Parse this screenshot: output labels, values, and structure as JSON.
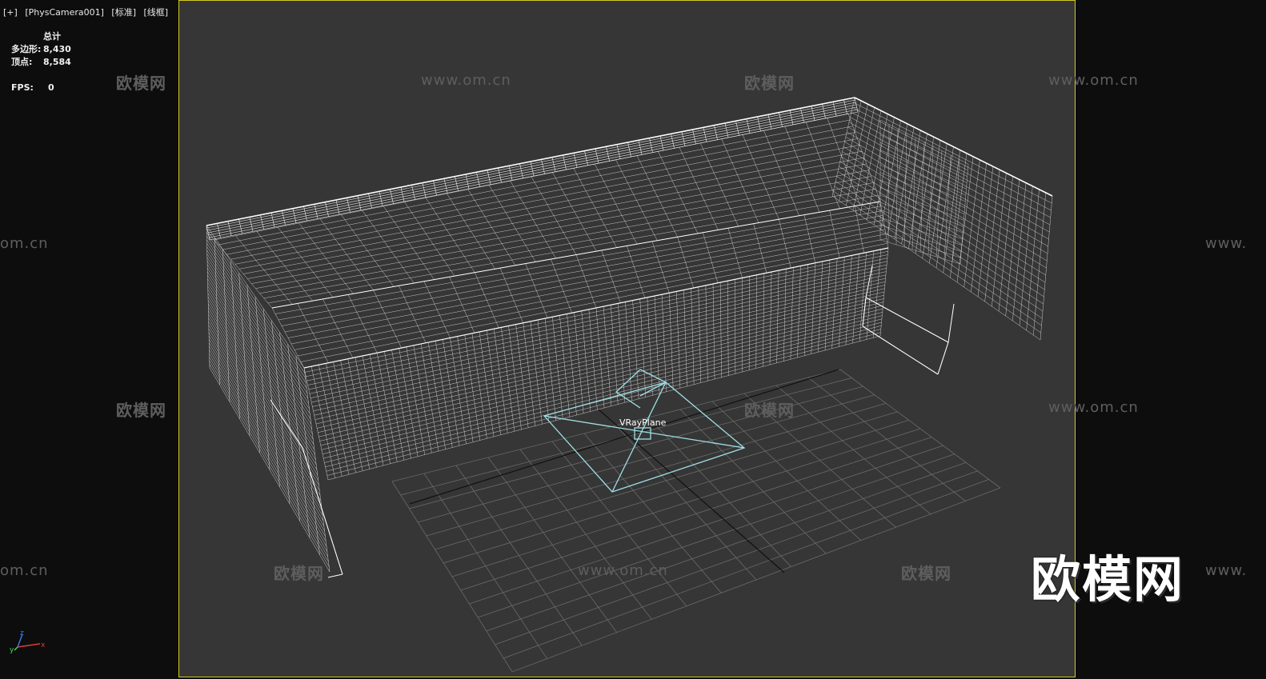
{
  "viewport": {
    "plus_label": "[+]",
    "camera_label": "[PhysCamera001]",
    "shading_label": "[标准]",
    "mode_label": "[线框]"
  },
  "stats": {
    "header": "总计",
    "polygons_label": "多边形:",
    "polygons_value": "8,430",
    "vertices_label": "顶点:",
    "vertices_value": "8,584",
    "fps_label": "FPS:",
    "fps_value": "0"
  },
  "scene": {
    "vray_plane_label": "VRayPlane"
  },
  "axis": {
    "x": "x",
    "y": "y",
    "z": "z"
  },
  "watermarks": {
    "logo_text": "欧模网",
    "url_text": "www.om.cn",
    "url_partial_left": "om.cn",
    "url_partial_right": "www.",
    "big_logo": "欧模网"
  },
  "colors": {
    "viewport_bg": "#363636",
    "frame_border": "#d4cb21",
    "wire": "#ffffff",
    "grid": "#6a6a6a",
    "vray": "#9fe0e6"
  }
}
